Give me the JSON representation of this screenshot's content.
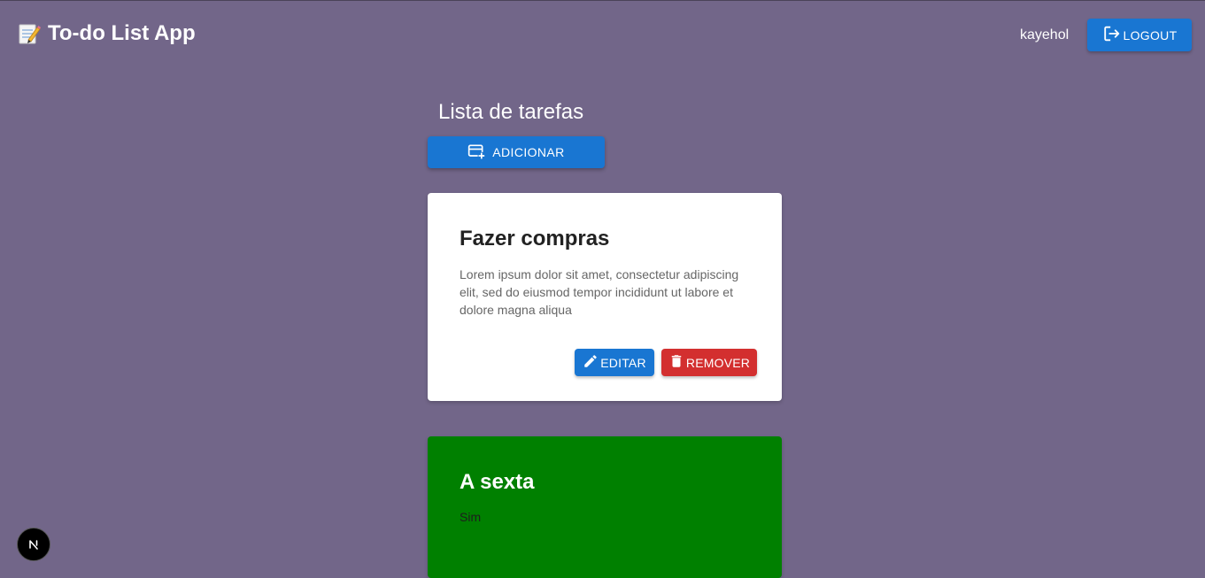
{
  "header": {
    "title": "To-do List App",
    "username": "kayehol",
    "logout_label": "LOGOUT"
  },
  "main": {
    "section_title": "Lista de tarefas",
    "add_label": "ADICIONAR"
  },
  "tasks": [
    {
      "title": "Fazer compras",
      "description": "Lorem ipsum dolor sit amet, consectetur adipiscing elit, sed do eiusmod tempor incididunt ut labore et dolore magna aliqua",
      "edit_label": "EDITAR",
      "remove_label": "REMOVER",
      "background": "#ffffff"
    },
    {
      "title": "A sexta",
      "description": "Sim",
      "background": "#008000"
    }
  ],
  "colors": {
    "background": "#726689",
    "primary": "#1976d2",
    "danger": "#d32f2f",
    "done": "#008000"
  },
  "icons": [
    "memo-icon",
    "logout-icon",
    "add-card-icon",
    "edit-icon",
    "delete-icon",
    "nextjs-icon"
  ]
}
